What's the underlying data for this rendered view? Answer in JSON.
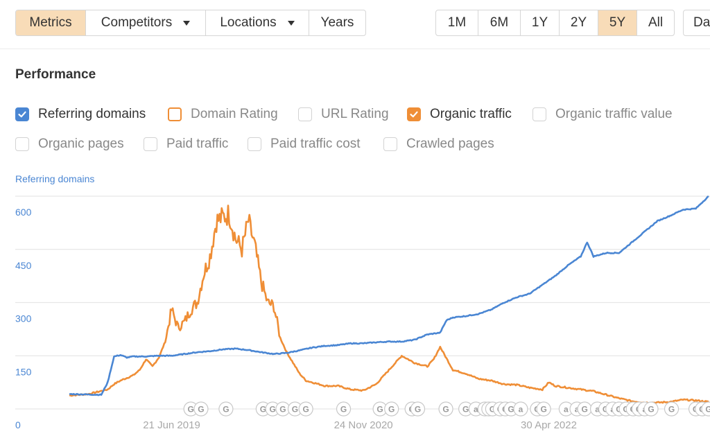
{
  "toolbar": {
    "view_tabs": [
      {
        "label": "Metrics",
        "active": true,
        "dropdown": false
      },
      {
        "label": "Competitors",
        "active": false,
        "dropdown": true
      },
      {
        "label": "Locations",
        "active": false,
        "dropdown": true
      },
      {
        "label": "Years",
        "active": false,
        "dropdown": false
      }
    ],
    "range_tabs": [
      {
        "label": "1M",
        "active": false
      },
      {
        "label": "6M",
        "active": false
      },
      {
        "label": "1Y",
        "active": false
      },
      {
        "label": "2Y",
        "active": false
      },
      {
        "label": "5Y",
        "active": true
      },
      {
        "label": "All",
        "active": false
      }
    ],
    "date_button_label": "Daily"
  },
  "section": {
    "title": "Performance"
  },
  "metrics": [
    {
      "label": "Referring domains",
      "checked": true,
      "style": "checked-blue"
    },
    {
      "label": "Domain Rating",
      "checked": false,
      "style": "outline-orange"
    },
    {
      "label": "URL Rating",
      "checked": false,
      "style": "plain"
    },
    {
      "label": "Organic traffic",
      "checked": true,
      "style": "checked-orange"
    },
    {
      "label": "Organic traffic value",
      "checked": false,
      "style": "plain"
    },
    {
      "label": "Organic pages",
      "checked": false,
      "style": "plain"
    },
    {
      "label": "Paid traffic",
      "checked": false,
      "style": "plain"
    },
    {
      "label": "Paid traffic cost",
      "checked": false,
      "style": "plain"
    },
    {
      "label": "Crawled pages",
      "checked": false,
      "style": "plain"
    }
  ],
  "colors": {
    "referring_domains": "#4a86d3",
    "organic_traffic": "#ef8e36",
    "active_tab": "#f8dcb8"
  },
  "chart_data": {
    "type": "line",
    "title": "Performance",
    "ylabel": "Referring domains",
    "xlabel": "",
    "ylim": [
      0,
      600
    ],
    "yticks": [
      0,
      150,
      300,
      450,
      600
    ],
    "xlim_index": [
      0,
      100
    ],
    "xticks": [
      {
        "label": "21 Jun 2019",
        "x": 16
      },
      {
        "label": "24 Nov 2020",
        "x": 46
      },
      {
        "label": "30 Apr 2022",
        "x": 75
      }
    ],
    "grid": true,
    "legend": "top-left (checkbox list)",
    "series": [
      {
        "name": "Referring domains",
        "color": "#4a86d3",
        "x": [
          0,
          5,
          6,
          7,
          8,
          9,
          10,
          12,
          14,
          16,
          18,
          20,
          22,
          24,
          26,
          28,
          30,
          32,
          34,
          36,
          38,
          40,
          42,
          44,
          46,
          48,
          50,
          52,
          54,
          56,
          58,
          59,
          60,
          62,
          64,
          66,
          68,
          70,
          72,
          74,
          76,
          78,
          80,
          81,
          82,
          84,
          86,
          88,
          90,
          92,
          94,
          96,
          98,
          100
        ],
        "values": [
          42,
          40,
          75,
          148,
          152,
          145,
          148,
          148,
          150,
          150,
          155,
          160,
          163,
          168,
          170,
          166,
          160,
          155,
          158,
          165,
          173,
          178,
          180,
          185,
          185,
          188,
          190,
          190,
          195,
          210,
          215,
          250,
          258,
          262,
          268,
          280,
          300,
          315,
          325,
          350,
          375,
          405,
          430,
          470,
          430,
          440,
          440,
          470,
          500,
          530,
          545,
          562,
          565,
          600
        ]
      },
      {
        "name": "Organic traffic",
        "color": "#ef8e36",
        "x": [
          0,
          3,
          6,
          7,
          8,
          10,
          11,
          12,
          13,
          14,
          15,
          16,
          17,
          18,
          19,
          20,
          21,
          22,
          23,
          24,
          25,
          26,
          27,
          28,
          29,
          30,
          31,
          32,
          33,
          34,
          35,
          36,
          37,
          38,
          40,
          42,
          44,
          46,
          48,
          50,
          52,
          54,
          56,
          57,
          58,
          60,
          62,
          64,
          66,
          68,
          70,
          72,
          74,
          75,
          76,
          78,
          80,
          82,
          84,
          86,
          88,
          90,
          92,
          94,
          96,
          98,
          100
        ],
        "values": [
          38,
          42,
          55,
          70,
          80,
          95,
          110,
          140,
          120,
          145,
          190,
          280,
          230,
          245,
          280,
          300,
          380,
          430,
          530,
          540,
          550,
          480,
          450,
          530,
          460,
          360,
          300,
          290,
          200,
          160,
          130,
          100,
          80,
          75,
          65,
          65,
          55,
          52,
          70,
          110,
          150,
          130,
          120,
          140,
          175,
          110,
          100,
          85,
          80,
          70,
          68,
          60,
          55,
          75,
          65,
          60,
          55,
          50,
          40,
          30,
          22,
          18,
          18,
          20,
          26,
          24,
          20
        ]
      }
    ],
    "annotations": [
      {
        "x": 19.0,
        "icon": "G"
      },
      {
        "x": 20.6,
        "icon": "G"
      },
      {
        "x": 24.5,
        "icon": "G"
      },
      {
        "x": 30.3,
        "icon": "G"
      },
      {
        "x": 31.8,
        "icon": "G"
      },
      {
        "x": 33.4,
        "icon": "G"
      },
      {
        "x": 35.3,
        "icon": "G"
      },
      {
        "x": 37.0,
        "icon": "G"
      },
      {
        "x": 42.9,
        "icon": "G"
      },
      {
        "x": 48.6,
        "icon": "G"
      },
      {
        "x": 50.4,
        "icon": "G"
      },
      {
        "x": 53.6,
        "icon": "G"
      },
      {
        "x": 54.5,
        "icon": "G"
      },
      {
        "x": 58.9,
        "icon": "G"
      },
      {
        "x": 62.0,
        "icon": "G"
      },
      {
        "x": 63.6,
        "icon": "a"
      },
      {
        "x": 65.0,
        "icon": "G"
      },
      {
        "x": 65.6,
        "icon": "G"
      },
      {
        "x": 66.2,
        "icon": "G"
      },
      {
        "x": 67.4,
        "icon": "G"
      },
      {
        "x": 68.2,
        "icon": "G"
      },
      {
        "x": 69.1,
        "icon": "G"
      },
      {
        "x": 70.6,
        "icon": "a"
      },
      {
        "x": 73.2,
        "icon": "G"
      },
      {
        "x": 74.2,
        "icon": "G"
      },
      {
        "x": 77.7,
        "icon": "a"
      },
      {
        "x": 79.4,
        "icon": "a"
      },
      {
        "x": 80.6,
        "icon": "G"
      },
      {
        "x": 82.6,
        "icon": "a"
      },
      {
        "x": 83.9,
        "icon": "G"
      },
      {
        "x": 85.0,
        "icon": "a"
      },
      {
        "x": 86.0,
        "icon": "G"
      },
      {
        "x": 87.1,
        "icon": "G"
      },
      {
        "x": 88.2,
        "icon": "G"
      },
      {
        "x": 89.1,
        "icon": "G"
      },
      {
        "x": 90.0,
        "icon": "a"
      },
      {
        "x": 91.0,
        "icon": "G"
      },
      {
        "x": 94.2,
        "icon": "G"
      },
      {
        "x": 98.0,
        "icon": "G"
      },
      {
        "x": 99.0,
        "icon": "G"
      },
      {
        "x": 100.0,
        "icon": "G"
      }
    ]
  }
}
